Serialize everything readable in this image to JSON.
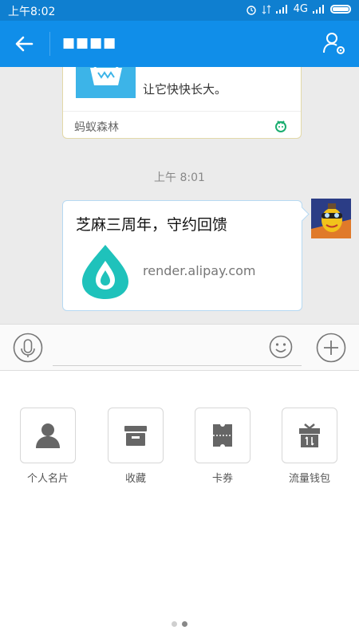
{
  "status_bar": {
    "time": "上午8:02",
    "network": "4G",
    "battery_level": 1.0
  },
  "header": {
    "contact_name": "■■■■",
    "back_icon": "back-arrow-icon",
    "settings_icon": "person-settings-icon"
  },
  "messages": {
    "card1": {
      "description": "让它快快长大。",
      "source": "蚂蚁森林"
    },
    "timestamp": "上午 8:01",
    "card2": {
      "title": "芝麻三周年，守约回馈",
      "domain": "render.alipay.com"
    }
  },
  "input_bar": {
    "placeholder": ""
  },
  "tools": [
    {
      "label": "个人名片",
      "icon": "person-icon"
    },
    {
      "label": "收藏",
      "icon": "box-icon"
    },
    {
      "label": "卡券",
      "icon": "ticket-icon"
    },
    {
      "label": "流量钱包",
      "icon": "gift-icon"
    }
  ],
  "pager": {
    "pages": 2,
    "current": 2
  },
  "colors": {
    "header": "#108ee9",
    "status": "#0f7fd0",
    "chat_bg": "#ebebeb"
  }
}
